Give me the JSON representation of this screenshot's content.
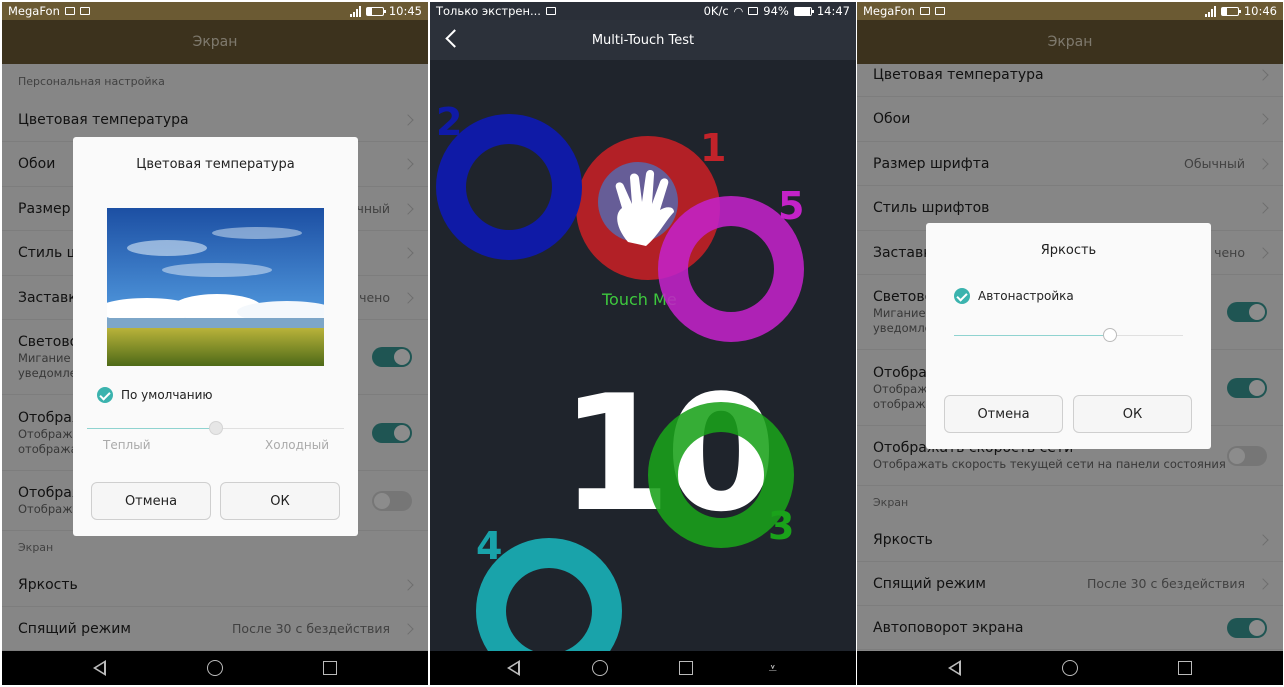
{
  "status_left": {
    "carrier": "MegaFon",
    "time": "10:45"
  },
  "status_mid": {
    "carrier": "Только экстрен...",
    "speed": "0K/c",
    "battery": "94%",
    "time": "14:47"
  },
  "status_right": {
    "carrier": "MegaFon",
    "time": "10:46"
  },
  "screen_title": "Экран",
  "left": {
    "section_personal": "Персональная настройка",
    "rows": [
      {
        "label": "Цветовая температура"
      },
      {
        "label": "Обои"
      },
      {
        "label": "Размер ш",
        "value": "чный"
      },
      {
        "label": "Стиль ш"
      },
      {
        "label": "Заставк",
        "value": "чено"
      },
      {
        "label": "Светово",
        "sub1": "Мигание с",
        "sub2": "уведомле"
      },
      {
        "label": "Отображ",
        "sub1": "Отображе",
        "sub2": "отобража"
      },
      {
        "label": "Отображ",
        "sub1": "Отобража"
      }
    ],
    "section_screen": "Экран",
    "rows2": [
      {
        "label": "Яркость"
      },
      {
        "label": "Спящий режим",
        "value": "После 30 с бездействия"
      }
    ],
    "dialog": {
      "title": "Цветовая температура",
      "checkbox_label": "По умолчанию",
      "slider_value": 0.5,
      "warm_label": "Теплый",
      "cold_label": "Холодный",
      "cancel": "Отмена",
      "ok": "ОК"
    }
  },
  "middle": {
    "title": "Multi-Touch Test",
    "touch_me": "Touch Me",
    "count": "10",
    "touches": [
      {
        "label": "1",
        "color": "#cc2026"
      },
      {
        "label": "2",
        "color": "#0f1aa6"
      },
      {
        "label": "3",
        "color": "#1aa21a"
      },
      {
        "label": "4",
        "color": "#19a3aa"
      },
      {
        "label": "5",
        "color": "#c322c8"
      }
    ]
  },
  "right": {
    "rows": [
      {
        "label": "Цветовая температура"
      },
      {
        "label": "Обои"
      },
      {
        "label": "Размер шрифта",
        "value": "Обычный"
      },
      {
        "label": "Стиль шрифтов"
      },
      {
        "label": "Заставк",
        "value": "чено"
      },
      {
        "label": "Светово",
        "sub1": "Мигание с",
        "sub2": "уведомле"
      },
      {
        "label": "Отображ",
        "sub1": "Отображе",
        "sub2": "отобража"
      },
      {
        "label": "Отображать скорость сети",
        "sub1": "Отображать скорость текущей сети на панели состояния"
      }
    ],
    "section_screen": "Экран",
    "rows2": [
      {
        "label": "Яркость"
      },
      {
        "label": "Спящий режим",
        "value": "После 30 с бездействия"
      },
      {
        "label": "Автоповорот экрана"
      }
    ],
    "dialog": {
      "title": "Яркость",
      "checkbox_label": "Автонастройка",
      "slider_value": 0.68,
      "cancel": "Отмена",
      "ok": "ОК"
    }
  },
  "colors": {
    "accent": "#3a9c98",
    "header": "#6d5b35",
    "mt_background": "#1f242c"
  }
}
